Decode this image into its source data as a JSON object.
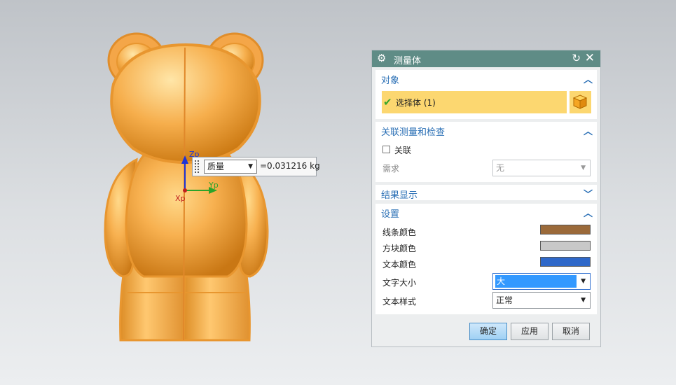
{
  "viewport": {
    "measure_type": "质量",
    "measure_value": "=0.031216 kg",
    "axis_z": "Zp",
    "axis_y": "Yp",
    "axis_x": "Xp",
    "model_color": "#f5a442"
  },
  "dialog": {
    "title": "测量体",
    "title_bar_color": "#5f8c86",
    "sections": {
      "object": {
        "label": "对象",
        "select_body_label": "选择体 (1)"
      },
      "associative": {
        "label": "关联测量和检查",
        "associative_label": "关联",
        "requirement_label": "需求",
        "requirement_value": "无"
      },
      "results": {
        "label": "结果显示"
      },
      "settings": {
        "label": "设置",
        "line_color_label": "线条颜色",
        "line_color": "#9b6a3a",
        "block_color_label": "方块颜色",
        "block_color": "#c8c8c8",
        "text_color_label": "文本颜色",
        "text_color": "#2f68c9",
        "text_size_label": "文字大小",
        "text_size_value": "大",
        "text_style_label": "文本样式",
        "text_style_value": "正常"
      }
    },
    "buttons": {
      "ok": "确定",
      "apply": "应用",
      "cancel": "取消"
    }
  }
}
